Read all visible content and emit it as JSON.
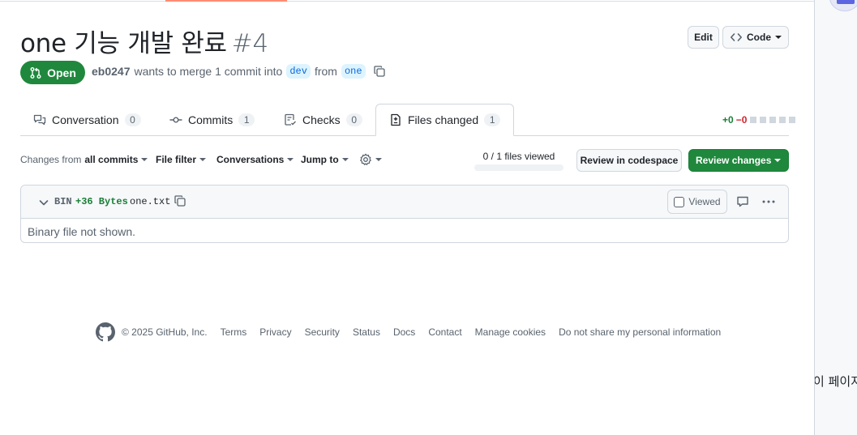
{
  "pr": {
    "title": "one 기능 개발 완료",
    "number": "#4",
    "state": "Open",
    "author": "eb0247",
    "merge_text": "wants to merge 1 commit into",
    "base_branch": "dev",
    "from_text": "from",
    "head_branch": "one"
  },
  "header_buttons": {
    "edit": "Edit",
    "code": "Code"
  },
  "tabs": [
    {
      "label": "Conversation",
      "count": "0"
    },
    {
      "label": "Commits",
      "count": "1"
    },
    {
      "label": "Checks",
      "count": "0"
    },
    {
      "label": "Files changed",
      "count": "1"
    }
  ],
  "diffstat": {
    "additions": "+0",
    "deletions": "−0"
  },
  "toolbar": {
    "changes_prefix": "Changes from",
    "changes_value": "all commits",
    "file_filter": "File filter",
    "conversations": "Conversations",
    "jump_to": "Jump to",
    "files_viewed": "0 / 1 files viewed",
    "files_viewed_fraction": 0,
    "review_codespace": "Review in codespace",
    "review_changes": "Review changes"
  },
  "file": {
    "type": "BIN",
    "bytes": "+36 Bytes",
    "name": "one.txt",
    "viewed_label": "Viewed",
    "body": "Binary file not shown."
  },
  "footer": {
    "copyright": "© 2025 GitHub, Inc.",
    "links": [
      "Terms",
      "Privacy",
      "Security",
      "Status",
      "Docs",
      "Contact",
      "Manage cookies",
      "Do not share my personal information"
    ]
  },
  "side_panel": {
    "text": "이 페이지"
  },
  "colors": {
    "open_green": "#1f883d",
    "link_blue": "#0969da",
    "accent_orange": "#fd8c73"
  }
}
